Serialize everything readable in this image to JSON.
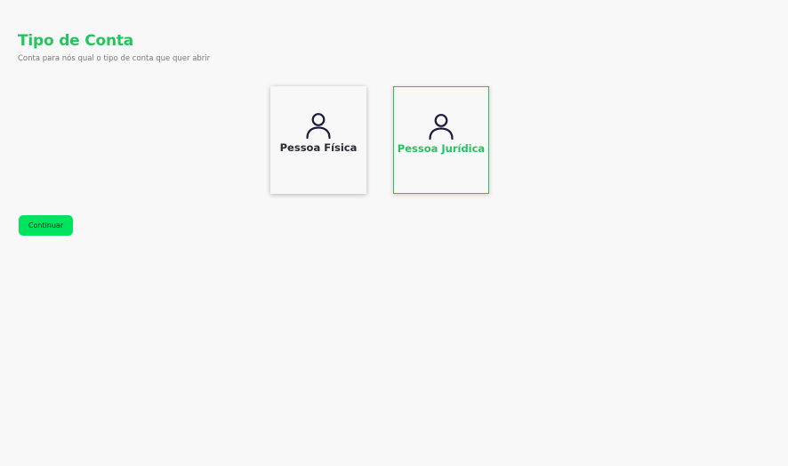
{
  "header": {
    "title": "Tipo de Conta",
    "subtitle": "Conta para nós qual o tipo de conta que quer abrir"
  },
  "options": [
    {
      "label": "Pessoa Física",
      "icon": "user-icon",
      "selected": false
    },
    {
      "label": "Pessoa Jurídica",
      "icon": "user-icon",
      "selected": true
    }
  ],
  "actions": {
    "continue_label": "Continuar"
  },
  "colors": {
    "accent": "#22c55e",
    "button": "#00e35f",
    "background": "#f8f8f8",
    "icon": "#1c1a3a"
  }
}
